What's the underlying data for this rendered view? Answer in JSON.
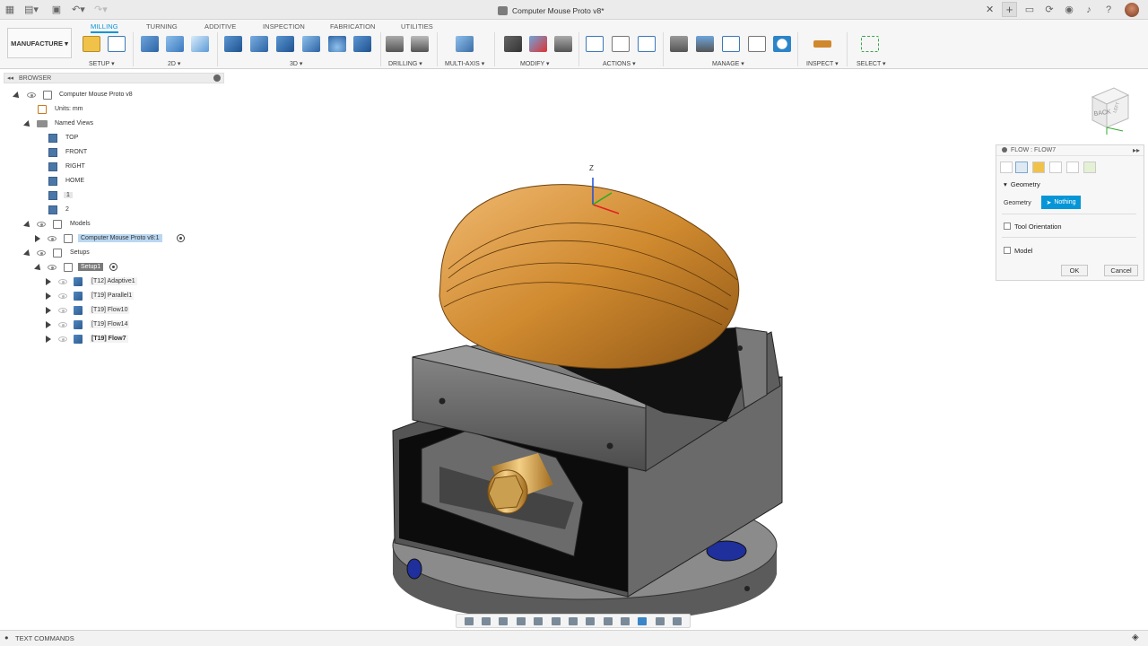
{
  "window": {
    "title": "Computer Mouse Proto v8*"
  },
  "toolbar": {
    "workspace": "MANUFACTURE",
    "tabs": [
      "MILLING",
      "TURNING",
      "ADDITIVE",
      "INSPECTION",
      "FABRICATION",
      "UTILITIES"
    ],
    "groups": [
      "SETUP",
      "2D",
      "3D",
      "DRILLING",
      "MULTI-AXIS",
      "MODIFY",
      "ACTIONS",
      "MANAGE",
      "INSPECT",
      "SELECT"
    ]
  },
  "browser": {
    "title": "BROWSER",
    "root": "Computer Mouse Proto v8",
    "units": "Units: mm",
    "named_views": "Named Views",
    "views": [
      "TOP",
      "FRONT",
      "RIGHT",
      "HOME",
      "1",
      "2"
    ],
    "models": "Models",
    "model_item": "Computer Mouse Proto v8:1",
    "setups": "Setups",
    "setup_item": "Setup1",
    "operations": [
      "[T12] Adaptive1",
      "[T19] Parallel1",
      "[T19] Flow10",
      "[T19] Flow14",
      "[T19] Flow7"
    ]
  },
  "panel": {
    "title": "FLOW : FLOW7",
    "geometry_section": "Geometry",
    "geometry_label": "Geometry",
    "geometry_value": "Nothing",
    "tool_orientation": "Tool Orientation",
    "model": "Model",
    "ok": "OK",
    "cancel": "Cancel"
  },
  "viewcube": {
    "face_label": "BACK",
    "side_label": "LEFT"
  },
  "viewport": {
    "axis_label": "Z"
  },
  "statusbar": {
    "text_commands": "TEXT COMMANDS"
  },
  "colors": {
    "accent": "#0696d7",
    "part": "#d08a2f",
    "vise": "#5a5a5a"
  }
}
